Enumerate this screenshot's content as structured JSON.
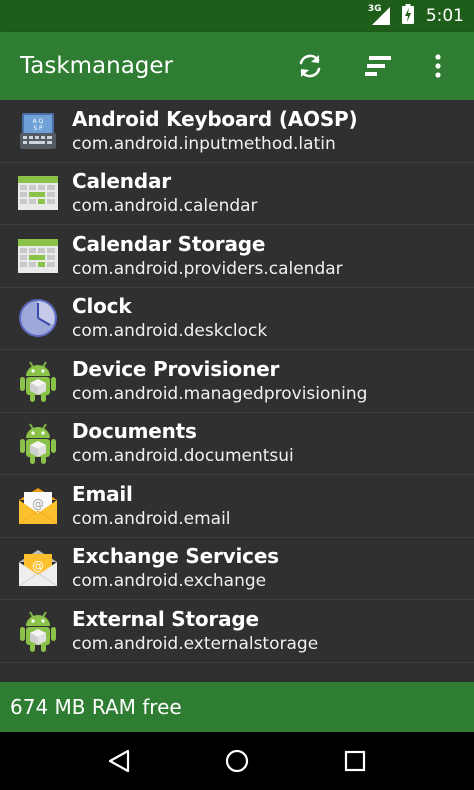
{
  "status_bar": {
    "network_label": "3G",
    "time": "5:01"
  },
  "app_bar": {
    "title": "Taskmanager",
    "actions": [
      "refresh-icon",
      "sort-icon",
      "more-vert-icon"
    ]
  },
  "apps": [
    {
      "name": "Android Keyboard (AOSP)",
      "package": "com.android.inputmethod.latin",
      "icon": "keyboard-icon"
    },
    {
      "name": "Calendar",
      "package": "com.android.calendar",
      "icon": "calendar-icon"
    },
    {
      "name": "Calendar Storage",
      "package": "com.android.providers.calendar",
      "icon": "calendar-icon"
    },
    {
      "name": "Clock",
      "package": "com.android.deskclock",
      "icon": "clock-icon"
    },
    {
      "name": "Device Provisioner",
      "package": "com.android.managedprovisioning",
      "icon": "android-robot-icon"
    },
    {
      "name": "Documents",
      "package": "com.android.documentsui",
      "icon": "android-robot-icon"
    },
    {
      "name": "Email",
      "package": "com.android.email",
      "icon": "email-icon"
    },
    {
      "name": "Exchange Services",
      "package": "com.android.exchange",
      "icon": "exchange-icon"
    },
    {
      "name": "External Storage",
      "package": "com.android.externalstorage",
      "icon": "android-robot-icon"
    }
  ],
  "footer": {
    "ram_free": "674 MB RAM free"
  },
  "colors": {
    "status_bar": "#1f5e1a",
    "app_bar": "#2e7d32",
    "list_background": "#303030",
    "nav_bar": "#000000"
  }
}
